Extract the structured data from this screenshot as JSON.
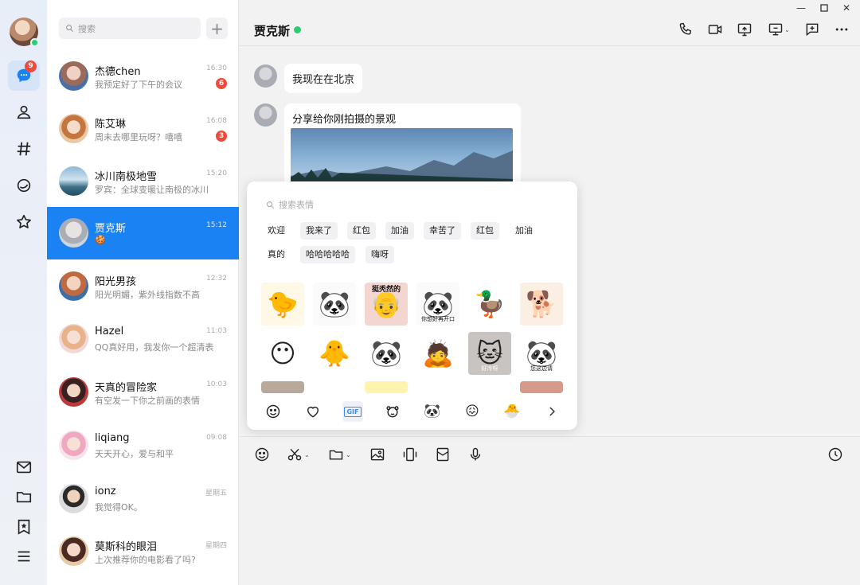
{
  "search": {
    "placeholder": "搜索"
  },
  "rail": {
    "messages_badge": "9"
  },
  "conversations": [
    {
      "name": "杰德chen",
      "time": "16:30",
      "preview": "我预定好了下午的会议",
      "badge": "6"
    },
    {
      "name": "陈艾琳",
      "time": "16:08",
      "preview": "周末去哪里玩呀？嘻嘻",
      "badge": "3"
    },
    {
      "name": "冰川南极地雪",
      "time": "15:20",
      "preview": "罗宾：全球变暖让南极的冰川",
      "badge": ""
    },
    {
      "name": "贾克斯",
      "time": "15:12",
      "preview": "🍪",
      "badge": ""
    },
    {
      "name": "阳光男孩",
      "time": "12:32",
      "preview": "阳光明媚，紫外线指数不高",
      "badge": ""
    },
    {
      "name": "Hazel",
      "time": "11:03",
      "preview": "QQ真好用，我发你一个超清表情",
      "badge": ""
    },
    {
      "name": "天真的冒险家",
      "time": "10:03",
      "preview": "有空发一下你之前画的表情",
      "badge": ""
    },
    {
      "name": "liqiang",
      "time": "09:08",
      "preview": "天天开心，爱与和平",
      "badge": ""
    },
    {
      "name": "ionz",
      "time": "星期五",
      "preview": "我觉得OK。",
      "badge": ""
    },
    {
      "name": "莫斯科的眼泪",
      "time": "星期四",
      "preview": "上次推荐你的电影看了吗?",
      "badge": ""
    }
  ],
  "chat": {
    "title": "贾克斯",
    "messages": [
      {
        "text": "我现在在北京"
      },
      {
        "text": "分享给你刚拍摄的景观"
      }
    ]
  },
  "emoji": {
    "search_placeholder": "搜索表情",
    "tags_row1": [
      "欢迎",
      "我来了",
      "红包",
      "加油",
      "幸苦了",
      "红包",
      "加油"
    ],
    "tags_row2": [
      "真的",
      "哈哈哈哈哈",
      "嗨呀"
    ],
    "sticker_captions": {
      "s3_top": "挺秃然的",
      "s4": "你想好再开口",
      "s11": "好冷呀",
      "s12": "您这边请"
    },
    "gif_label": "GIF"
  },
  "colors": {
    "accent": "#1a82f2",
    "badge": "#f04a3a",
    "online": "#2ecc71"
  }
}
